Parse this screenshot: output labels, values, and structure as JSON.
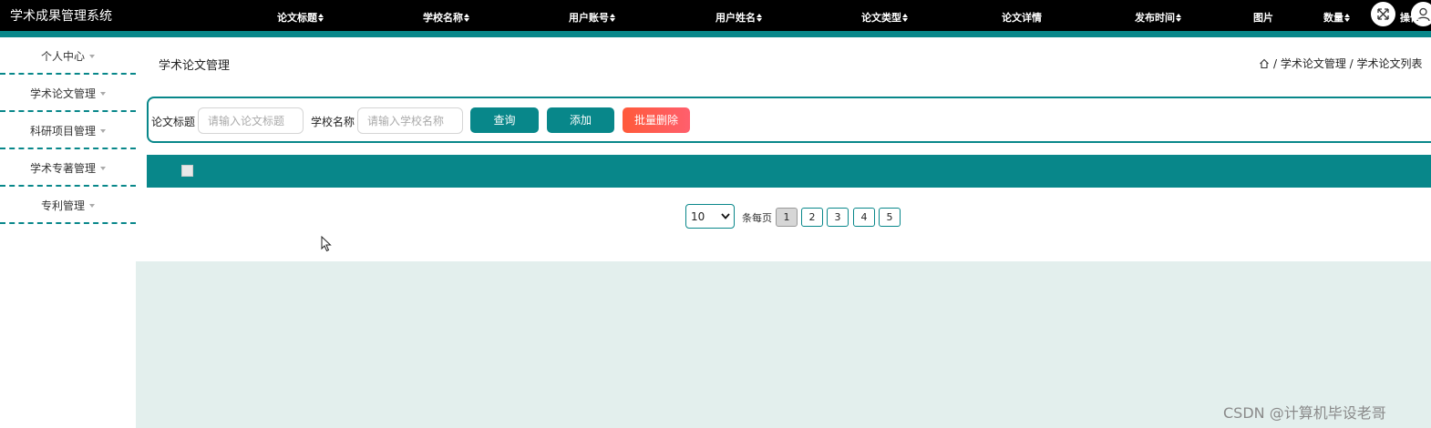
{
  "app": {
    "title": "学术成果管理系统"
  },
  "topbar": {
    "icons": [
      "fullscreen-icon",
      "user-icon"
    ]
  },
  "sidebar": {
    "items": [
      {
        "label": "个人中心"
      },
      {
        "label": "学术论文管理"
      },
      {
        "label": "科研项目管理"
      },
      {
        "label": "学术专著管理"
      },
      {
        "label": "专利管理"
      }
    ]
  },
  "page": {
    "title": "学术论文管理",
    "breadcrumb": "/ 学术论文管理 / 学术论文列表"
  },
  "search": {
    "title_label": "论文标题",
    "title_placeholder": "请输入论文标题",
    "school_label": "学校名称",
    "school_placeholder": "请输入学校名称",
    "query_label": "查询",
    "add_label": "添加",
    "batch_delete_label": "批量删除"
  },
  "table": {
    "columns": [
      "论文标题",
      "学校名称",
      "用户账号",
      "用户姓名",
      "论文类型",
      "论文详情",
      "发布时间",
      "图片",
      "数量",
      "操作"
    ]
  },
  "pagination": {
    "page_size": "10",
    "per_page_label": "条每页",
    "pages": [
      "1",
      "2",
      "3",
      "4",
      "5"
    ],
    "current_page": "1"
  },
  "watermark": "CSDN @计算机毕设老哥",
  "colors": {
    "accent": "#08878a",
    "danger": "#ff5a3a",
    "background": "#e3efed",
    "topbar": "#000000"
  }
}
